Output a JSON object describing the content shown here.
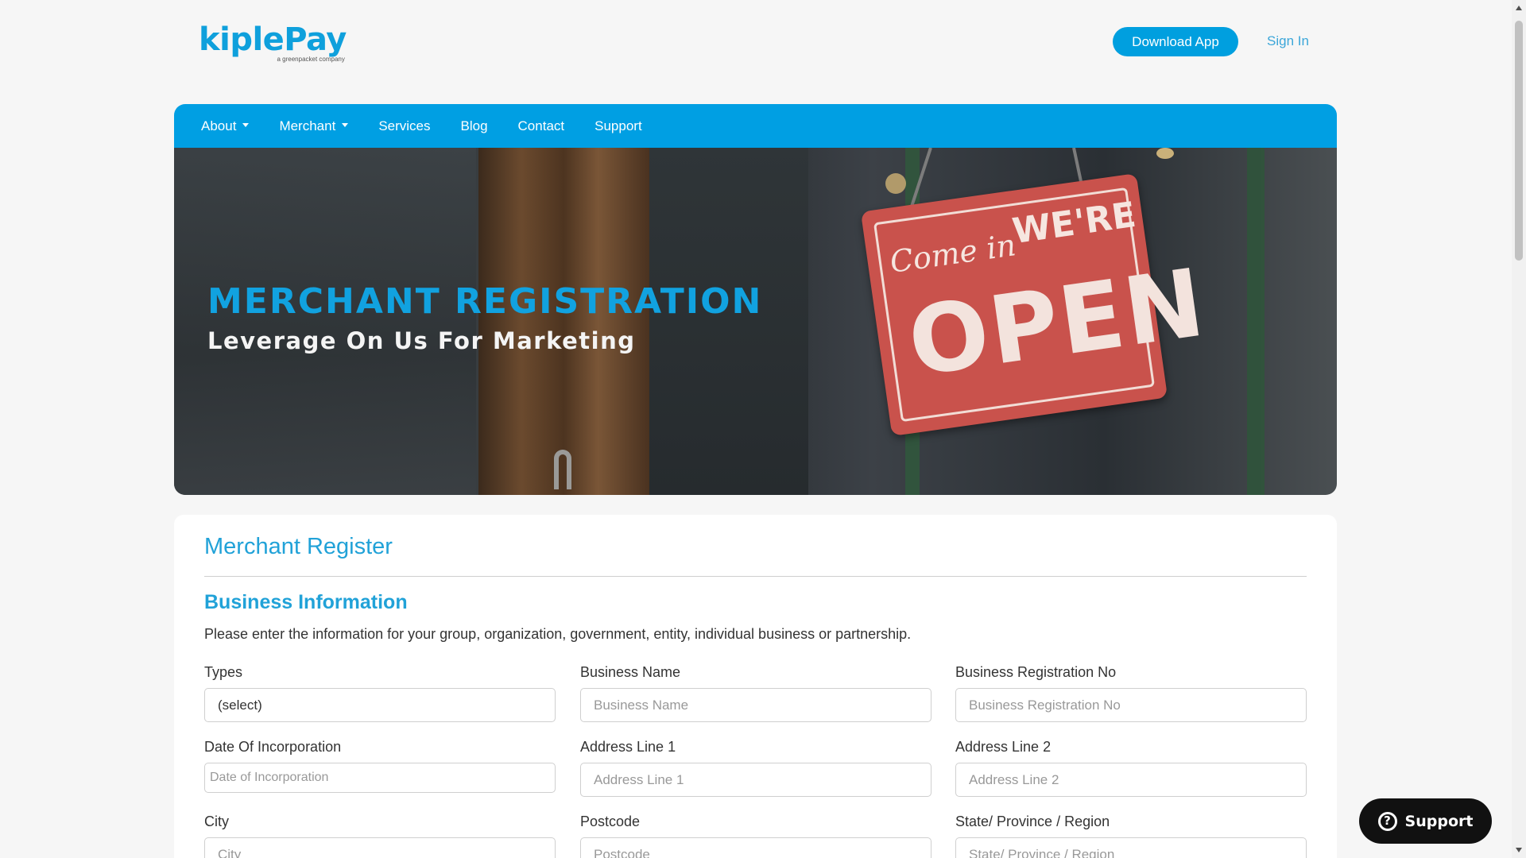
{
  "header": {
    "logo_text": "kiplePay",
    "logo_sub": "a greenpacket company",
    "download_label": "Download App",
    "signin_label": "Sign In"
  },
  "nav": {
    "items": [
      {
        "label": "About",
        "dropdown": true
      },
      {
        "label": "Merchant",
        "dropdown": true
      },
      {
        "label": "Services",
        "dropdown": false
      },
      {
        "label": "Blog",
        "dropdown": false
      },
      {
        "label": "Contact",
        "dropdown": false
      },
      {
        "label": "Support",
        "dropdown": false
      }
    ]
  },
  "banner": {
    "title": "MERCHANT REGISTRATION",
    "subtitle": "Leverage On Us For Marketing",
    "sign_comein": "Come in",
    "sign_were": "WE'RE",
    "sign_open": "OPEN"
  },
  "form": {
    "title": "Merchant Register",
    "section_title": "Business Information",
    "section_desc": "Please enter the information for your group, organization, government, entity, individual business or partnership.",
    "fields": [
      {
        "label": "Types",
        "value": "(select)",
        "type": "select"
      },
      {
        "label": "Business Name",
        "placeholder": "Business Name"
      },
      {
        "label": "Business Registration No",
        "placeholder": "Business Registration No"
      },
      {
        "label": "Date Of Incorporation",
        "placeholder": "Date of Incorporation",
        "type": "date"
      },
      {
        "label": "Address Line 1",
        "placeholder": "Address Line 1"
      },
      {
        "label": "Address Line 2",
        "placeholder": "Address Line 2"
      },
      {
        "label": "City",
        "placeholder": "City"
      },
      {
        "label": "Postcode",
        "placeholder": "Postcode"
      },
      {
        "label": "State/ Province / Region",
        "placeholder": "State/ Province / Region"
      }
    ]
  },
  "support_widget": {
    "label": "Support",
    "icon": "question-circle-icon"
  },
  "colors": {
    "brand_blue": "#009fe3",
    "heading_blue": "#21a2d8",
    "support_bg": "#111111"
  }
}
